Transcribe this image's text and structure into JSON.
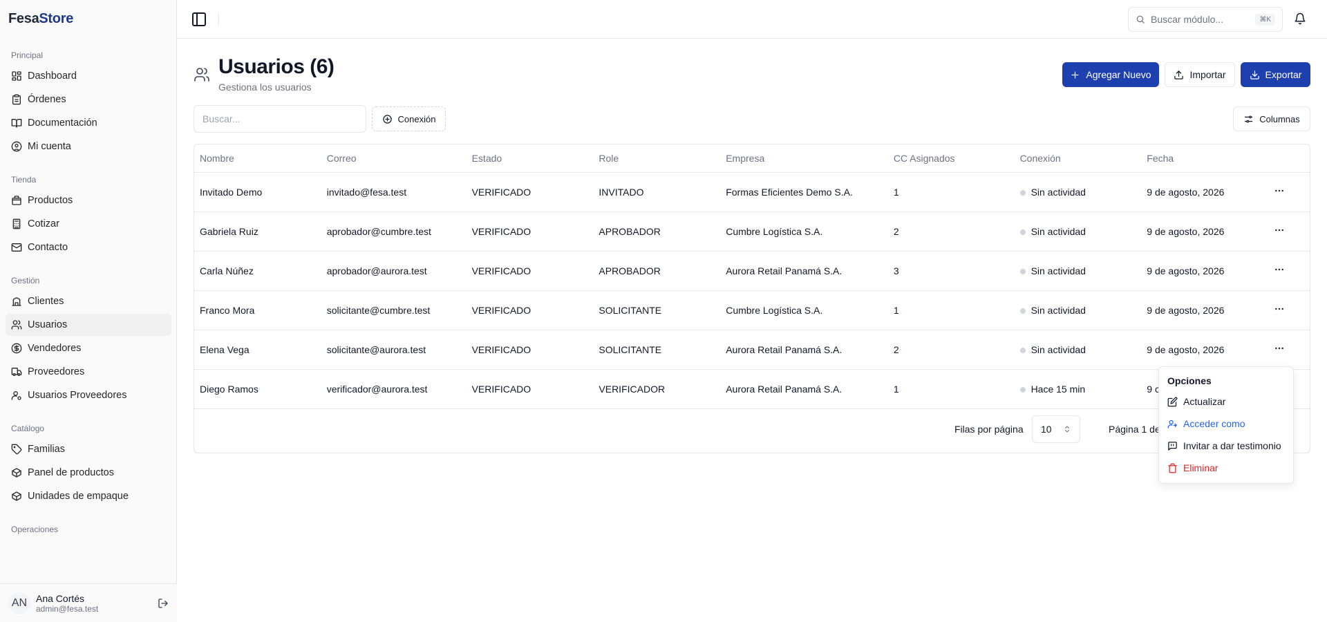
{
  "brand": {
    "part1": "Fesa",
    "part2": "Store"
  },
  "sidebar": {
    "groups": [
      {
        "label": "Principal",
        "items": [
          {
            "label": "Dashboard",
            "icon": "dashboard-icon"
          },
          {
            "label": "Órdenes",
            "icon": "clipboard-icon"
          },
          {
            "label": "Documentación",
            "icon": "book-icon"
          },
          {
            "label": "Mi cuenta",
            "icon": "user-circle-icon"
          }
        ]
      },
      {
        "label": "Tienda",
        "items": [
          {
            "label": "Productos",
            "icon": "package-icon"
          },
          {
            "label": "Cotizar",
            "icon": "calculator-icon"
          },
          {
            "label": "Contacto",
            "icon": "mail-icon"
          }
        ]
      },
      {
        "label": "Gestión",
        "items": [
          {
            "label": "Clientes",
            "icon": "building-icon"
          },
          {
            "label": "Usuarios",
            "icon": "users-icon",
            "active": true
          },
          {
            "label": "Vendedores",
            "icon": "dollar-circle-icon"
          },
          {
            "label": "Proveedores",
            "icon": "truck-icon"
          },
          {
            "label": "Usuarios Proveedores",
            "icon": "user-cog-icon"
          }
        ]
      },
      {
        "label": "Catálogo",
        "items": [
          {
            "label": "Familias",
            "icon": "tag-icon"
          },
          {
            "label": "Panel de productos",
            "icon": "box-icon"
          },
          {
            "label": "Unidades de empaque",
            "icon": "box-icon"
          }
        ]
      },
      {
        "label": "Operaciones",
        "items": []
      }
    ]
  },
  "user": {
    "initials": "AN",
    "name": "Ana Cortés",
    "email": "admin@fesa.test"
  },
  "topbar": {
    "search_placeholder": "Buscar módulo...",
    "shortcut": "⌘K"
  },
  "header": {
    "title": "Usuarios (6)",
    "subtitle": "Gestiona los usuarios"
  },
  "actions": {
    "add": "Agregar Nuevo",
    "import": "Importar",
    "export": "Exportar"
  },
  "toolbar": {
    "search_placeholder": "Buscar...",
    "connection_filter": "Conexión",
    "columns": "Columnas"
  },
  "table": {
    "columns": [
      "Nombre",
      "Correo",
      "Estado",
      "Role",
      "Empresa",
      "CC Asignados",
      "Conexión",
      "Fecha"
    ],
    "rows": [
      {
        "nombre": "Invitado Demo",
        "correo": "invitado@fesa.test",
        "estado": "VERIFICADO",
        "role": "INVITADO",
        "empresa": "Formas Eficientes Demo S.A.",
        "cc": "1",
        "conexion": "Sin actividad",
        "fecha": "9 de agosto, 2026"
      },
      {
        "nombre": "Gabriela Ruiz",
        "correo": "aprobador@cumbre.test",
        "estado": "VERIFICADO",
        "role": "APROBADOR",
        "empresa": "Cumbre Logística S.A.",
        "cc": "2",
        "conexion": "Sin actividad",
        "fecha": "9 de agosto, 2026"
      },
      {
        "nombre": "Carla Núñez",
        "correo": "aprobador@aurora.test",
        "estado": "VERIFICADO",
        "role": "APROBADOR",
        "empresa": "Aurora Retail Panamá S.A.",
        "cc": "3",
        "conexion": "Sin actividad",
        "fecha": "9 de agosto, 2026"
      },
      {
        "nombre": "Franco Mora",
        "correo": "solicitante@cumbre.test",
        "estado": "VERIFICADO",
        "role": "SOLICITANTE",
        "empresa": "Cumbre Logística S.A.",
        "cc": "1",
        "conexion": "Sin actividad",
        "fecha": "9 de agosto, 2026"
      },
      {
        "nombre": "Elena Vega",
        "correo": "solicitante@aurora.test",
        "estado": "VERIFICADO",
        "role": "SOLICITANTE",
        "empresa": "Aurora Retail Panamá S.A.",
        "cc": "2",
        "conexion": "Sin actividad",
        "fecha": "9 de agosto, 2026"
      },
      {
        "nombre": "Diego Ramos",
        "correo": "verificador@aurora.test",
        "estado": "VERIFICADO",
        "role": "VERIFICADOR",
        "empresa": "Aurora Retail Panamá S.A.",
        "cc": "1",
        "conexion": "Hace 15 min",
        "fecha": "9 c"
      }
    ]
  },
  "pagination": {
    "rows_label": "Filas por página",
    "rows_value": "10",
    "page_label": "Página 1 de"
  },
  "menu": {
    "title": "Opciones",
    "update": "Actualizar",
    "login_as": "Acceder como",
    "invite": "Invitar a dar testimonio",
    "delete": "Eliminar"
  },
  "colors": {
    "primary": "#1e40af",
    "link": "#2563eb",
    "danger": "#dc2626"
  }
}
